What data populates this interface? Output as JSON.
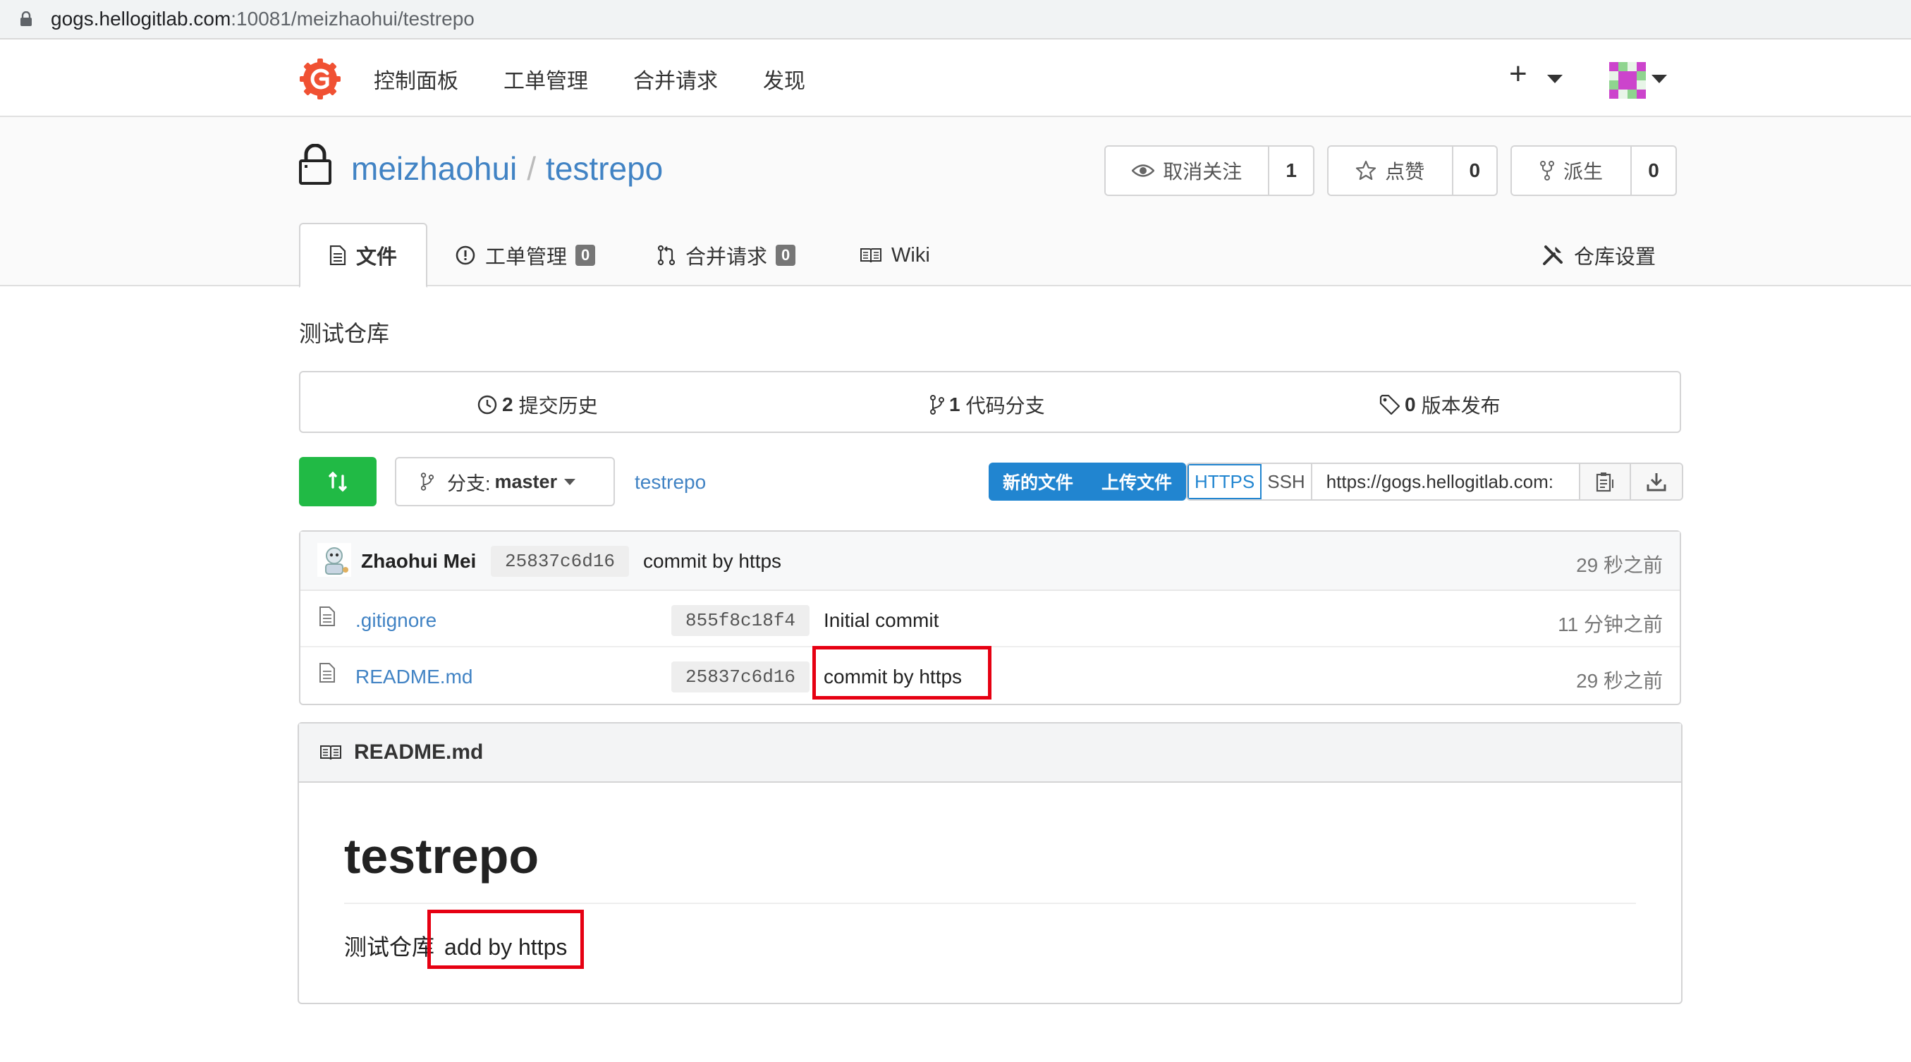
{
  "browser": {
    "url_host": "gogs.hellogitlab.com",
    "url_rest": ":10081/meizhaohui/testrepo"
  },
  "nav": {
    "items": [
      "控制面板",
      "工单管理",
      "合并请求",
      "发现"
    ],
    "plus": "+"
  },
  "repo": {
    "owner": "meizhaohui",
    "separator": "/",
    "name": "testrepo",
    "description": "测试仓库",
    "watch": {
      "label": "取消关注",
      "count": "1"
    },
    "star": {
      "label": "点赞",
      "count": "0"
    },
    "fork": {
      "label": "派生",
      "count": "0"
    }
  },
  "tabs": {
    "files": "文件",
    "issues": "工单管理",
    "issues_count": "0",
    "pulls": "合并请求",
    "pulls_count": "0",
    "wiki": "Wiki",
    "settings": "仓库设置"
  },
  "stats": {
    "commits_count": "2",
    "commits_label": "提交历史",
    "branches_count": "1",
    "branches_label": "代码分支",
    "releases_count": "0",
    "releases_label": "版本发布"
  },
  "toolbar": {
    "branch_prefix": "分支:",
    "branch": "master",
    "path": "testrepo",
    "new_file": "新的文件",
    "upload_file": "上传文件",
    "https": "HTTPS",
    "ssh": "SSH",
    "clone_url": "https://gogs.hellogitlab.com:"
  },
  "latest_commit": {
    "author": "Zhaohui Mei",
    "sha": "25837c6d16",
    "message": "commit by https",
    "time": "29 秒之前"
  },
  "files": [
    {
      "name": ".gitignore",
      "sha": "855f8c18f4",
      "message": "Initial commit",
      "time": "11 分钟之前"
    },
    {
      "name": "README.md",
      "sha": "25837c6d16",
      "message": "commit by https",
      "time": "29 秒之前"
    }
  ],
  "readme": {
    "filename": "README.md",
    "heading": "testrepo",
    "para_prefix": "测试仓库",
    "para_highlight": "add by https"
  },
  "colors": {
    "link": "#4183c4",
    "green": "#21ba45",
    "blue": "#2185d0",
    "highlight_red": "#e60012"
  }
}
